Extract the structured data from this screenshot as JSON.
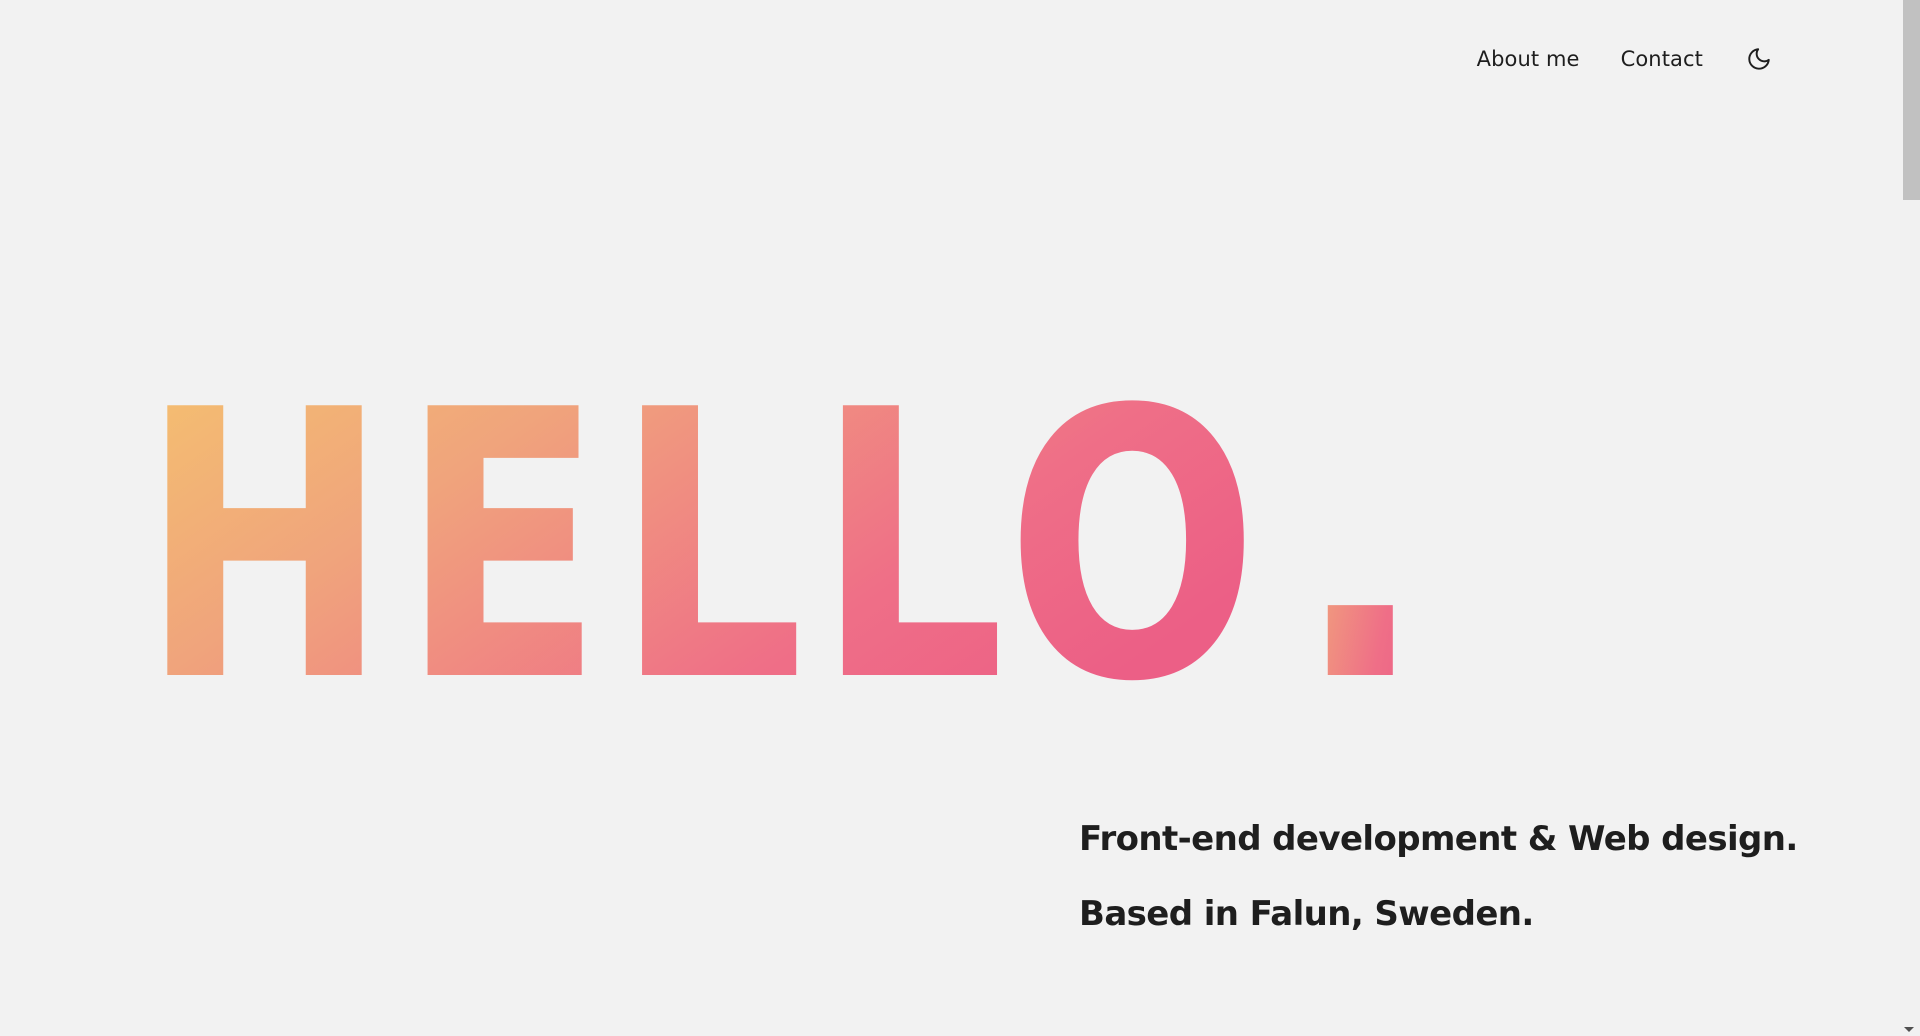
{
  "nav": {
    "items": [
      {
        "label": "About me"
      },
      {
        "label": "Contact"
      }
    ],
    "theme_toggle_icon": "moon-icon"
  },
  "hero": {
    "word": "HELLO",
    "dot": ".",
    "gradient": [
      "#f5c46e",
      "#f0a47c",
      "#ef6f87",
      "#ec5f86"
    ]
  },
  "tagline": {
    "line1": "Front-end development & Web design.",
    "line2": "Based in Falun, Sweden."
  },
  "colors": {
    "background": "#f2f2f2",
    "text": "#1e1e1e"
  }
}
